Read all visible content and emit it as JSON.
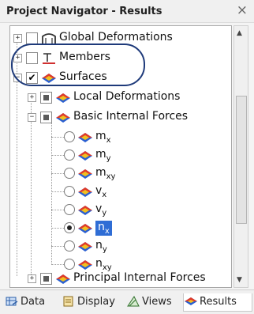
{
  "window": {
    "title": "Project Navigator - Results",
    "close_glyph": "×"
  },
  "tree": {
    "global": {
      "label": "Global Deformations"
    },
    "members": {
      "label": "Members"
    },
    "surfaces": {
      "label": "Surfaces"
    },
    "local": {
      "label": "Local Deformations"
    },
    "basic": {
      "label": "Basic Internal Forces"
    },
    "items": [
      {
        "sym": "m",
        "sub": "x"
      },
      {
        "sym": "m",
        "sub": "y"
      },
      {
        "sym": "m",
        "sub": "xy"
      },
      {
        "sym": "v",
        "sub": "x"
      },
      {
        "sym": "v",
        "sub": "y"
      },
      {
        "sym": "n",
        "sub": "x"
      },
      {
        "sym": "n",
        "sub": "y"
      },
      {
        "sym": "n",
        "sub": "xy"
      }
    ],
    "principal": {
      "label": "Principal Internal Forces"
    },
    "selected_index": 5
  },
  "tabs": [
    {
      "label": "Data",
      "icon": "data-icon"
    },
    {
      "label": "Display",
      "icon": "display-icon"
    },
    {
      "label": "Views",
      "icon": "views-icon"
    },
    {
      "label": "Results",
      "icon": "results-icon"
    }
  ],
  "active_tab": "Results",
  "colors": {
    "selection": "#2f6dd5",
    "highlight_ellipse": "#1e3a7a"
  }
}
